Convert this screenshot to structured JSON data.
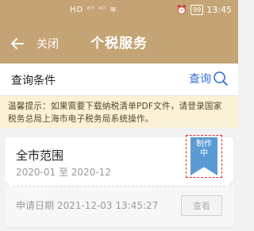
{
  "status_bar": {
    "signal": "HD ᵃˡˡ ᵃˡˡ ≋",
    "battery": "99",
    "time": "13:45"
  },
  "nav": {
    "close_label": "关闭",
    "title": "个税服务"
  },
  "query": {
    "title": "查询条件",
    "button_label": "查询"
  },
  "notice": {
    "text": "温馨提示：如果需要下载纳税清单PDF文件，请登录国家税务总局上海市电子税务局系统操作。"
  },
  "record": {
    "title": "全市范围",
    "range": "2020-01 至 2020-12",
    "status_line1": "制作",
    "status_line2": "中",
    "apply_date": "申请日期  2021-12-03 13:45:27",
    "view_label": "查看"
  },
  "colors": {
    "header": "#c4a474",
    "accent": "#2f6fd6",
    "ribbon": "#5b9bd5",
    "notice_bg": "#fbf1d6"
  }
}
